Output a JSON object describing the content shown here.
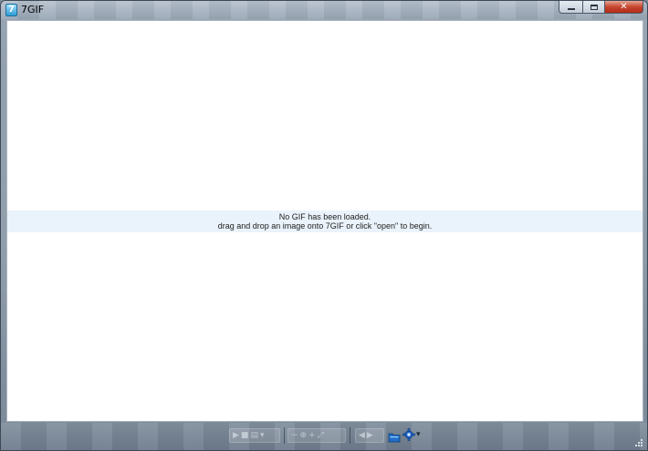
{
  "window": {
    "title": "7GIF",
    "icon": "7gif-app-icon",
    "icon_glyph": "7",
    "caption": {
      "minimize_glyph": "",
      "close_glyph": "✕"
    }
  },
  "viewer": {
    "message_line1": "No GIF has been loaded.",
    "message_line2": "drag and drop an image onto 7GIF or click \"open\" to begin."
  },
  "toolbar": {
    "play_glyph": "▶",
    "stop_glyph": "■",
    "frame_glyph": "▤",
    "dropdown_glyph": "▾",
    "zoom_out_glyph": "−",
    "zoom_glyph": "⊕",
    "zoom_in_glyph": "+",
    "fit_glyph": "⤢",
    "prev_glyph": "◀",
    "next_glyph": "▶",
    "settings_dropdown_glyph": "▾",
    "colors": {
      "open_icon": "#1f6fc8",
      "settings_icon": "#1e63c7"
    }
  }
}
